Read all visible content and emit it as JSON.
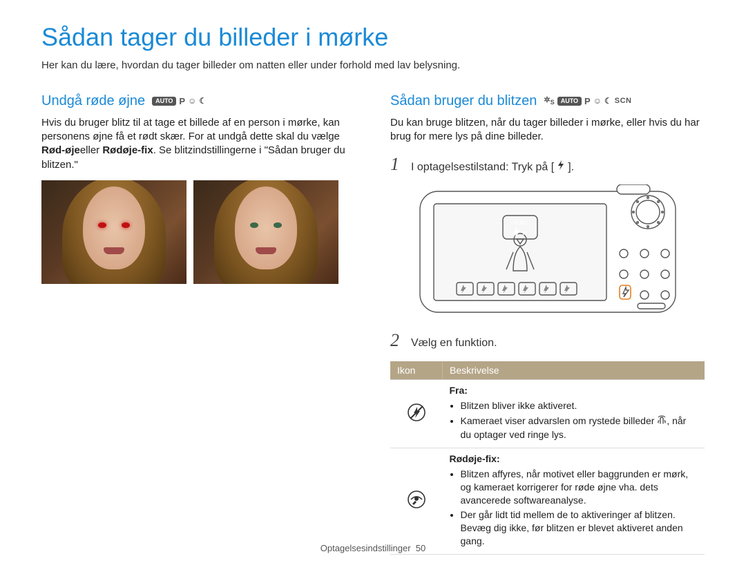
{
  "page": {
    "title": "Sådan tager du billeder i mørke",
    "subtitle": "Her kan du lære, hvordan du tager billeder om natten eller under forhold med lav belysning.",
    "footer_section": "Optagelsesindstillinger",
    "footer_page": "50"
  },
  "left": {
    "heading": "Undgå røde øjne",
    "modes": [
      "AUTO",
      "P",
      "face-icon",
      "moon-icon"
    ],
    "para_1a": "Hvis du bruger blitz til at tage et billede af en person i mørke, kan personens øjne få et rødt skær. For at undgå dette skal du vælge ",
    "bold1": "Rød-øje",
    "para_1b": "eller ",
    "bold2": "Rødøje-fix",
    "para_1c": ". Se blitzindstillingerne i \"Sådan bruger du blitzen.\"",
    "photo_alt_red": "Portræt med røde øjne",
    "photo_alt_fixed": "Portræt med korrigerede øjne"
  },
  "right": {
    "heading": "Sådan bruger du blitzen",
    "modes": [
      "S",
      "AUTO",
      "P",
      "face-icon",
      "moon-icon",
      "SCN"
    ],
    "para": "Du kan bruge blitzen, når du tager billeder i mørke, eller hvis du har brug for mere lys på dine billeder.",
    "step1": "I optagelsestilstand: Tryk på [",
    "step1_end": "].",
    "step2": "Vælg en funktion.",
    "camera": {
      "tooltip_label": "Auto",
      "flash_mode": "A"
    },
    "table": {
      "col_icon": "Ikon",
      "col_desc": "Beskrivelse",
      "rows": [
        {
          "icon": "flash-off-icon",
          "title": "Fra:",
          "bullets": [
            "Blitzen bliver ikke aktiveret.",
            "Kameraet viser advarslen om rystede billeder [hand-icon], når du optager ved ringe lys."
          ]
        },
        {
          "icon": "redeye-fix-icon",
          "title": "Rødøje-fix:",
          "bullets": [
            "Blitzen affyres, når motivet eller baggrunden er mørk, og kameraet korrigerer for røde øjne vha. dets avancerede softwareanalyse.",
            "Der går lidt tid mellem de to aktiveringer af blitzen. Bevæg dig ikke, før blitzen er blevet aktiveret anden gang."
          ]
        }
      ]
    }
  }
}
